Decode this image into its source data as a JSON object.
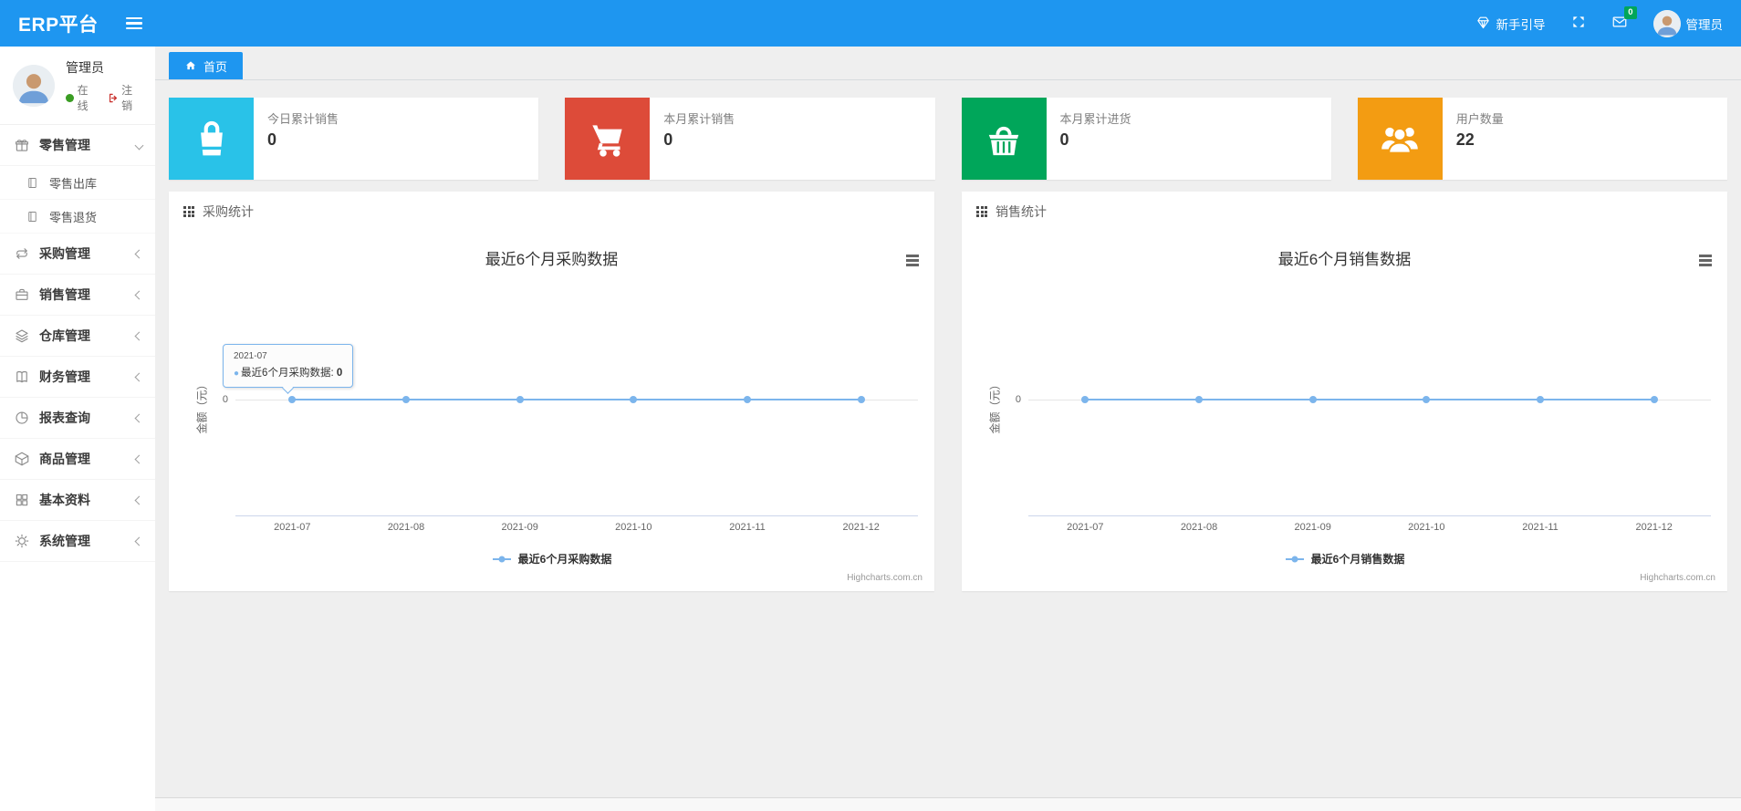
{
  "colors": {
    "navbar_blue": "#1e96f0",
    "card_aqua": "#29c2e8",
    "card_red": "#dd4b39",
    "card_green": "#00a65a",
    "card_orange": "#f39c12",
    "series_blue": "#7cb5ec",
    "badge_green": "#00a65a",
    "online_green": "#3a9d23"
  },
  "navbar": {
    "brand": "ERP平台",
    "menu_icon": "hamburger-icon",
    "guide_label": "新手引导",
    "guide_icon": "gem-icon",
    "fullscreen_icon": "fullscreen-icon",
    "message_icon": "envelope-icon",
    "message_badge": "0",
    "username": "管理员"
  },
  "sidebar": {
    "user": {
      "name": "管理员",
      "status": "在线",
      "logout": "注销"
    },
    "items": [
      {
        "label": "零售管理",
        "icon": "gift-icon",
        "state": "expanded",
        "children": [
          {
            "label": "零售出库",
            "icon": "journal-icon"
          },
          {
            "label": "零售退货",
            "icon": "journal-icon"
          }
        ]
      },
      {
        "label": "采购管理",
        "icon": "loop-icon",
        "state": "collapsed"
      },
      {
        "label": "销售管理",
        "icon": "briefcase-icon",
        "state": "collapsed"
      },
      {
        "label": "仓库管理",
        "icon": "layers-icon",
        "state": "collapsed"
      },
      {
        "label": "财务管理",
        "icon": "book-icon",
        "state": "collapsed"
      },
      {
        "label": "报表查询",
        "icon": "pie-chart-icon",
        "state": "collapsed"
      },
      {
        "label": "商品管理",
        "icon": "cube-icon",
        "state": "collapsed"
      },
      {
        "label": "基本资料",
        "icon": "grid-icon",
        "state": "collapsed"
      },
      {
        "label": "系统管理",
        "icon": "gear-icon",
        "state": "collapsed"
      }
    ]
  },
  "breadcrumb": {
    "home": "首页",
    "home_icon": "home-icon"
  },
  "stat_cards": [
    {
      "title": "今日累计销售",
      "value": "0",
      "icon": "bag-icon",
      "color": "#29c2e8"
    },
    {
      "title": "本月累计销售",
      "value": "0",
      "icon": "cart-icon",
      "color": "#dd4b39"
    },
    {
      "title": "本月累计进货",
      "value": "0",
      "icon": "basket-icon",
      "color": "#00a65a"
    },
    {
      "title": "用户数量",
      "value": "22",
      "icon": "users-icon",
      "color": "#f39c12"
    }
  ],
  "panels": [
    {
      "title": "采购统计",
      "icon": "grid-icon"
    },
    {
      "title": "销售统计",
      "icon": "grid-icon"
    }
  ],
  "chart_data": [
    {
      "type": "line",
      "title": "最近6个月采购数据",
      "categories": [
        "2021-07",
        "2021-08",
        "2021-09",
        "2021-10",
        "2021-11",
        "2021-12"
      ],
      "series": [
        {
          "name": "最近6个月采购数据",
          "values": [
            0,
            0,
            0,
            0,
            0,
            0
          ],
          "color": "#7cb5ec"
        }
      ],
      "xlabel": "",
      "ylabel": "金额（元）",
      "yticks": [
        "0"
      ],
      "ylim_note": "all values zero, single 0 tick centered",
      "grid": true,
      "legend_position": "bottom",
      "credits": "Highcharts.com.cn",
      "tooltip": {
        "visible": true,
        "category": "2021-07",
        "label": "最近6个月采购数据:",
        "value": "0"
      }
    },
    {
      "type": "line",
      "title": "最近6个月销售数据",
      "categories": [
        "2021-07",
        "2021-08",
        "2021-09",
        "2021-10",
        "2021-11",
        "2021-12"
      ],
      "series": [
        {
          "name": "最近6个月销售数据",
          "values": [
            0,
            0,
            0,
            0,
            0,
            0
          ],
          "color": "#7cb5ec"
        }
      ],
      "xlabel": "",
      "ylabel": "金额（元）",
      "yticks": [
        "0"
      ],
      "ylim_note": "all values zero, single 0 tick centered",
      "grid": true,
      "legend_position": "bottom",
      "credits": "Highcharts.com.cn",
      "tooltip": {
        "visible": false
      }
    }
  ]
}
